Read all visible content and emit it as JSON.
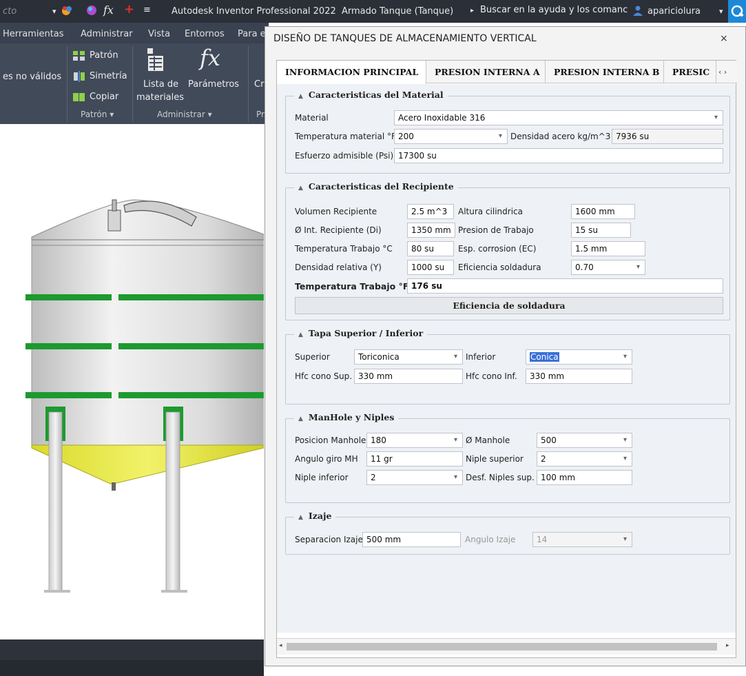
{
  "app": {
    "title_left": "cto",
    "title": "Autodesk Inventor Professional 2022",
    "document": "Armado Tanque (Tanque)",
    "search_placeholder": "Buscar en la ayuda y los comanc",
    "user": "apariciolura"
  },
  "ribbon": {
    "tabs": [
      "Herramientas",
      "Administrar",
      "Vista",
      "Entornos",
      "Para e"
    ],
    "left_cut_label": "es no válidos",
    "patron_items": [
      "Patrón",
      "Simetría",
      "Copiar"
    ],
    "lista_label_1": "Lista de",
    "lista_label_2": "materiales",
    "parametros_label": "Parámetros",
    "cut_cr": "Cr",
    "cut_pr": "Pr",
    "group_patron": "Patrón ▾",
    "group_administrar": "Administrar ▾"
  },
  "dialog": {
    "title": "DISEÑO DE TANQUES DE ALMACENAMIENTO VERTICAL",
    "close": "×",
    "tabs": [
      "INFORMACION PRINCIPAL",
      "PRESION INTERNA A",
      "PRESION INTERNA B",
      "PRESIC"
    ],
    "tab_scroll": "‹ ›",
    "material": {
      "legend": "Caracteristicas del Material",
      "material_label": "Material",
      "material_value": "Acero Inoxidable 316",
      "temp_label": "Temperatura material °F",
      "temp_value": "200",
      "dens_label": "Densidad acero kg/m^3",
      "dens_value": "7936 su",
      "esf_label": "Esfuerzo admisible (Psi)",
      "esf_value": "17300 su"
    },
    "recipiente": {
      "legend": "Caracteristicas del Recipiente",
      "vol_label": "Volumen Recipiente",
      "vol_value": "2.5 m^3",
      "alt_label": "Altura cilindrica",
      "alt_value": "1600 mm",
      "di_label": "Ø Int. Recipiente (Di)",
      "di_value": "1350 mm",
      "pres_label": "Presion de Trabajo",
      "pres_value": "15 su",
      "tt_label": "Temperatura Trabajo °C",
      "tt_value": "80 su",
      "ec_label": "Esp. corrosion (EC)",
      "ec_value": "1.5 mm",
      "dr_label": "Densidad relativa (Y)",
      "dr_value": "1000 su",
      "ef_label": "Eficiencia soldadura",
      "ef_value": "0.70",
      "ttf_label": "Temperatura Trabajo °F",
      "ttf_value": "176 su",
      "button": "Eficiencia de soldadura"
    },
    "tapa": {
      "legend": "Tapa Superior / Inferior",
      "sup_label": "Superior",
      "sup_value": "Toriconica",
      "inf_label": "Inferior",
      "inf_value": "Conica",
      "hsup_label": "Hfc cono Sup.",
      "hsup_value": "330 mm",
      "hinf_label": "Hfc cono Inf.",
      "hinf_value": "330 mm"
    },
    "manhole": {
      "legend": "ManHole y Niples",
      "pos_label": "Posicion Manhole",
      "pos_value": "180",
      "dia_label": "Ø Manhole",
      "dia_value": "500",
      "ang_label": "Angulo giro MH",
      "ang_value": "11 gr",
      "ns_label": "Niple superior",
      "ns_value": "2",
      "ni_label": "Niple inferior",
      "ni_value": "2",
      "desf_label": "Desf. Niples sup.",
      "desf_value": "100 mm"
    },
    "izaje": {
      "legend": "Izaje",
      "sep_label": "Separacion Izaje",
      "sep_value": "500 mm",
      "ang_label": "Angulo Izaje",
      "ang_value": "14"
    }
  },
  "colors": {
    "titlebar": "#2b2f38",
    "ribbon": "#414a59",
    "tank_body": "#e3e3e3",
    "ring_green": "#1c9a2f",
    "cone_yellow": "#e2e23a",
    "selection_blue": "#3a70d8"
  }
}
